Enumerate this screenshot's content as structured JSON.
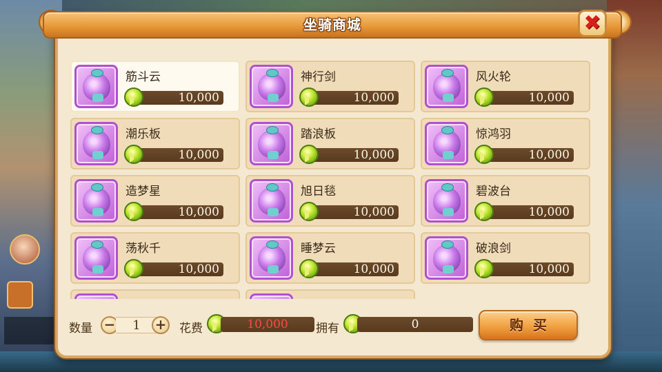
{
  "shop": {
    "title": "坐骑商城",
    "close_icon": "close-icon"
  },
  "items": [
    {
      "name": "筋斗云",
      "price": "10,000",
      "selected": true
    },
    {
      "name": "神行剑",
      "price": "10,000"
    },
    {
      "name": "风火轮",
      "price": "10,000"
    },
    {
      "name": "潮乐板",
      "price": "10,000"
    },
    {
      "name": "踏浪板",
      "price": "10,000"
    },
    {
      "name": "惊鸿羽",
      "price": "10,000"
    },
    {
      "name": "造梦星",
      "price": "10,000"
    },
    {
      "name": "旭日毯",
      "price": "10,000"
    },
    {
      "name": "碧波台",
      "price": "10,000"
    },
    {
      "name": "荡秋千",
      "price": "10,000"
    },
    {
      "name": "睡梦云",
      "price": "10,000"
    },
    {
      "name": "破浪剑",
      "price": "10,000"
    }
  ],
  "footer": {
    "quantity_label": "数量",
    "quantity_value": "1",
    "cost_label": "花费",
    "cost_value": "10,000",
    "owned_label": "拥有",
    "owned_value": "0",
    "buy_label": "购买"
  },
  "colors": {
    "panel_bg": "#f4e8d0",
    "title_orange": "#e89a3a",
    "price_bar": "#5a3a1e",
    "cost_red": "#e83a3a",
    "icon_purple": "#b050d0"
  }
}
